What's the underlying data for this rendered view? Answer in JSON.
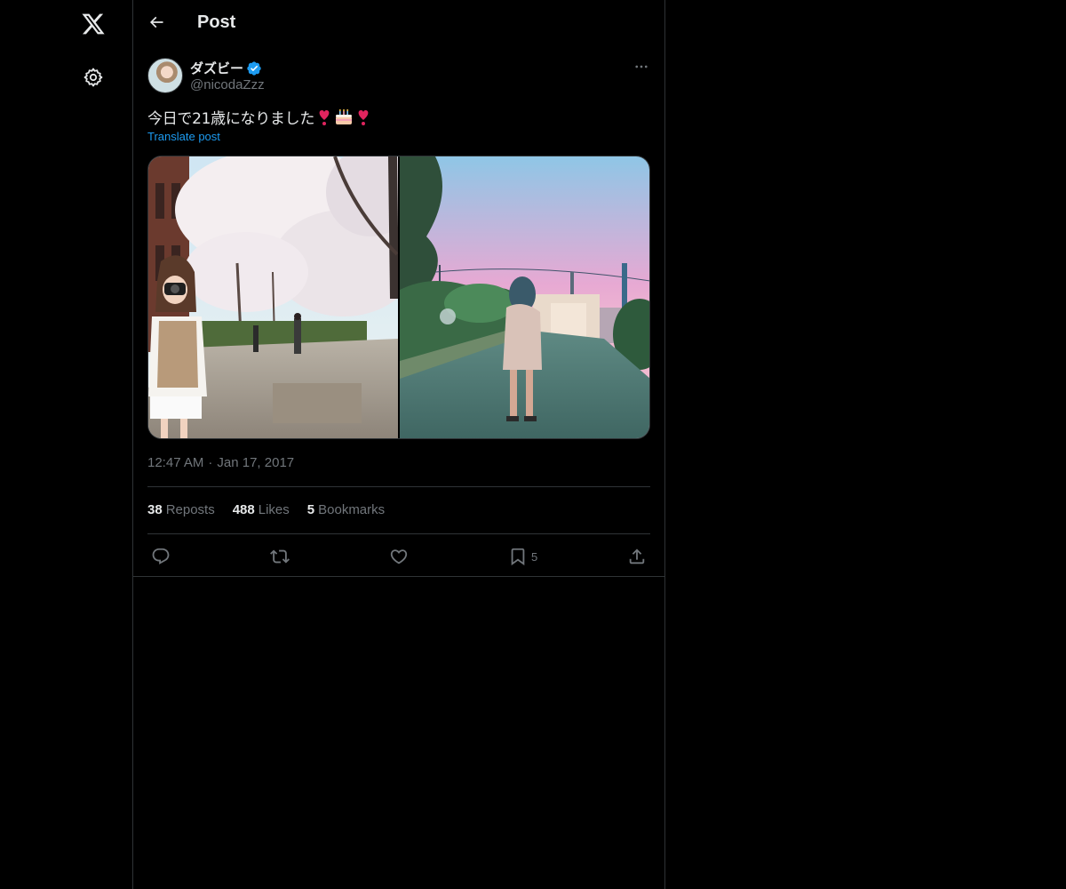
{
  "nav": {
    "logo_icon": "x-logo-icon",
    "settings_icon": "gear-icon"
  },
  "header": {
    "title": "Post"
  },
  "post": {
    "author": {
      "display_name": "ダズビー",
      "handle": "@nicodaZzz",
      "verified": true
    },
    "text": "今日で21歳になりました",
    "emojis": [
      "❣",
      "🎂",
      "❣"
    ],
    "translate_label": "Translate post",
    "time": "12:47 AM",
    "date": "Jan 17, 2017",
    "separator": "·",
    "stats": {
      "reposts_count": "38",
      "reposts_label": "Reposts",
      "likes_count": "488",
      "likes_label": "Likes",
      "bookmarks_count": "5",
      "bookmarks_label": "Bookmarks"
    },
    "actions": {
      "bookmark_count": "5"
    }
  },
  "colors": {
    "background": "#000000",
    "border": "#2f3336",
    "text_primary": "#e7e9ea",
    "text_secondary": "#71767b",
    "accent": "#1d9bf0"
  }
}
